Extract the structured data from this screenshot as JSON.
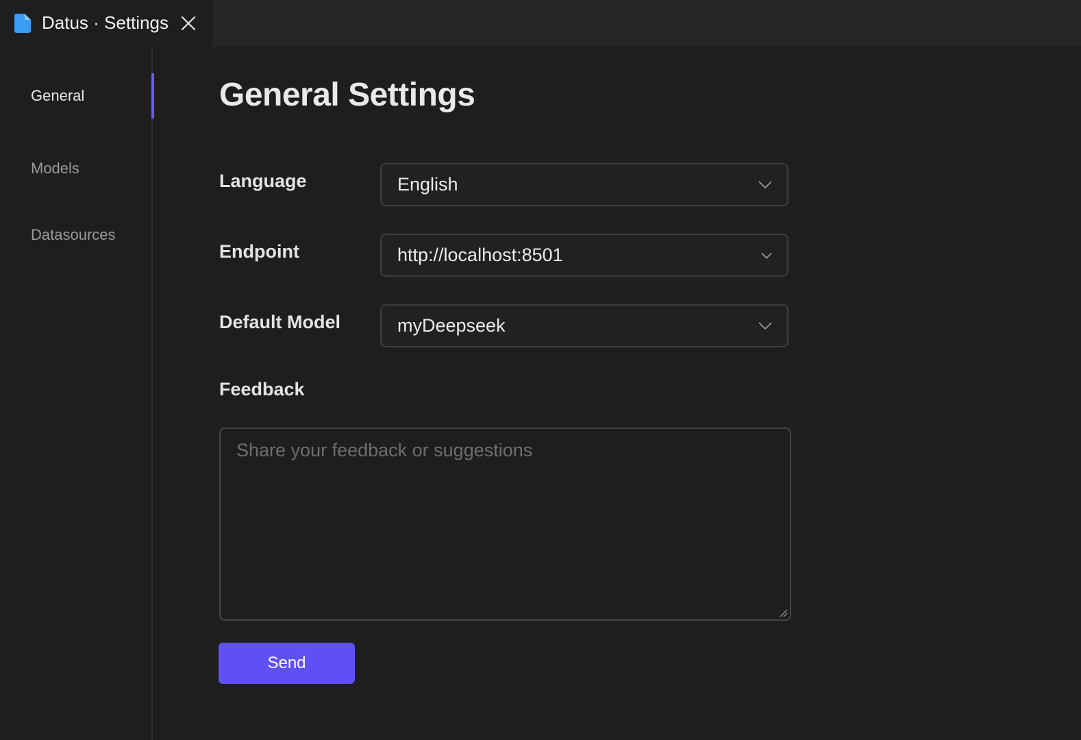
{
  "tab": {
    "title": "Datus · Settings",
    "icon": "file-icon",
    "icon_color": "#3b9cf5"
  },
  "sidebar": {
    "items": [
      {
        "label": "General",
        "active": true
      },
      {
        "label": "Models",
        "active": false
      },
      {
        "label": "Datasources",
        "active": false
      }
    ],
    "accent_color": "#6a5cf5"
  },
  "main": {
    "title": "General Settings",
    "language": {
      "label": "Language",
      "value": "English"
    },
    "endpoint": {
      "label": "Endpoint",
      "value": "http://localhost:8501"
    },
    "default_model": {
      "label": "Default Model",
      "value": "myDeepseek"
    },
    "feedback": {
      "label": "Feedback",
      "placeholder": "Share your feedback or suggestions",
      "value": ""
    },
    "send_label": "Send",
    "send_color": "#5e50f2"
  }
}
